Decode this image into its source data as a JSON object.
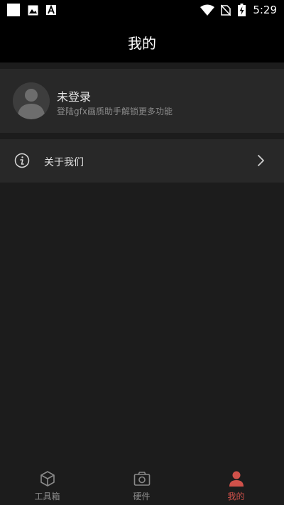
{
  "status_bar": {
    "time": "5:29",
    "icons": [
      "square-notification-icon",
      "image-icon",
      "font-icon",
      "wifi-icon",
      "no-sim-icon",
      "battery-charging-icon"
    ]
  },
  "header": {
    "title": "我的"
  },
  "profile": {
    "name": "未登录",
    "subtitle": "登陆gfx画质助手解锁更多功能",
    "avatar_icon": "person-icon"
  },
  "menu": {
    "items": [
      {
        "label": "关于我们",
        "icon": "info-icon",
        "trailing_icon": "chevron-right-icon"
      }
    ]
  },
  "bottom_nav": {
    "items": [
      {
        "label": "工具箱",
        "icon": "cube-icon",
        "active": false
      },
      {
        "label": "硬件",
        "icon": "camera-icon",
        "active": false
      },
      {
        "label": "我的",
        "icon": "person-icon",
        "active": true
      }
    ]
  },
  "colors": {
    "background": "#1c1c1c",
    "bar_background": "#000000",
    "card_background": "#282828",
    "nav_inactive": "#8a8a8a",
    "nav_active": "#d0514a"
  }
}
